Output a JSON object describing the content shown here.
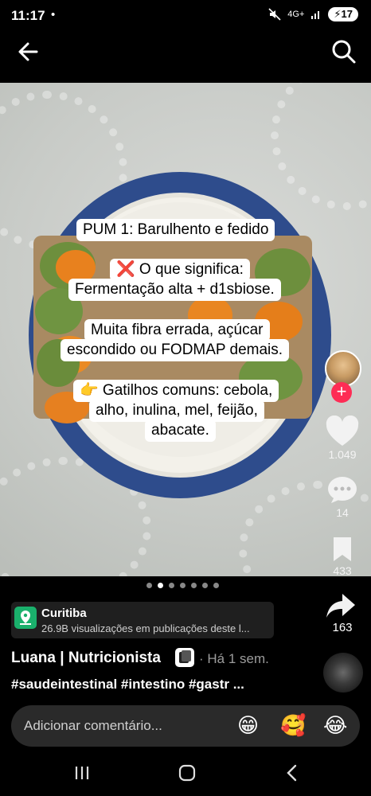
{
  "status_bar": {
    "time": "11:17",
    "dot": "•",
    "network": "4G+",
    "battery": "17"
  },
  "top_bar": {
    "back_icon": "arrow-left-icon",
    "search_icon": "search-icon"
  },
  "captions": [
    "PUM 1: Barulhento e fedido",
    "❌ O que significa:",
    "Fermentação alta + d1sbiose.",
    "Muita fibra errada, açúcar",
    "escondido ou FODMAP demais.",
    "👉 Gatilhos comuns: cebola,",
    "alho, inulina, mel, feijão,",
    "abacate."
  ],
  "actions": {
    "likes": "1.049",
    "comments": "14",
    "saves": "433",
    "shares": "163"
  },
  "carousel": {
    "total": 7,
    "active": 2
  },
  "location": {
    "title": "Curitiba",
    "subtitle": "26.9B visualizações em publicações deste l..."
  },
  "author": {
    "name": "Luana | Nutricionista",
    "time_ago": "· Há 1 sem.",
    "hashtags": "#saudeintestinal #intestino #gastr ..."
  },
  "comment_bar": {
    "placeholder": "Adicionar comentário...",
    "emojis": [
      "😁",
      "🥰",
      "😂"
    ]
  },
  "colors": {
    "accent": "#fe2c55",
    "location_pin": "#1ab06c",
    "plate_blue": "#2e4c8c"
  }
}
